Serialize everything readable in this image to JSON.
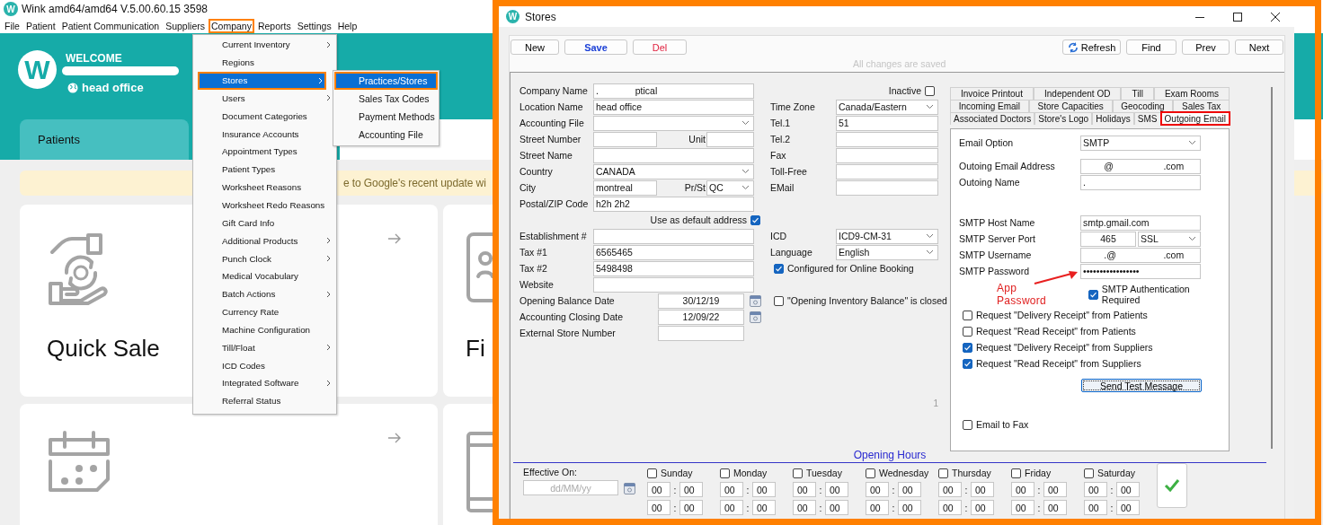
{
  "app": {
    "icon_letter": "W",
    "title": "Wink amd64/amd64 V.5.00.60.15 3598",
    "menu": [
      {
        "label": "File",
        "selected": false
      },
      {
        "label": "Patient",
        "selected": false
      },
      {
        "label": "Patient Communication",
        "selected": false
      },
      {
        "label": "Suppliers",
        "selected": false
      },
      {
        "label": "Company",
        "selected": true
      },
      {
        "label": "Reports",
        "selected": false
      },
      {
        "label": "Settings",
        "selected": false
      },
      {
        "label": "Help",
        "selected": false
      }
    ],
    "header": {
      "logo_letter": "W",
      "welcome": "WELCOME",
      "location": "head office"
    },
    "tab": "Patients",
    "notice": "e to Google's recent update wi",
    "cards": [
      {
        "kind": "money",
        "label": "Quick Sale",
        "arrow": true
      },
      {
        "kind": "tablet",
        "label": "Fi"
      },
      {
        "kind": "calendar",
        "arrow": true
      },
      {
        "kind": "phone"
      }
    ]
  },
  "company_menu": [
    {
      "label": "Current Inventory",
      "submenu": true,
      "selected": false
    },
    {
      "label": "Regions",
      "submenu": false,
      "selected": false
    },
    {
      "label": "Stores",
      "submenu": true,
      "selected": true
    },
    {
      "label": "Users",
      "submenu": true,
      "selected": false
    },
    {
      "label": "Document Categories",
      "submenu": false,
      "selected": false
    },
    {
      "label": "Insurance Accounts",
      "submenu": false,
      "selected": false
    },
    {
      "label": "Appointment Types",
      "submenu": false,
      "selected": false
    },
    {
      "label": "Patient Types",
      "submenu": false,
      "selected": false
    },
    {
      "label": "Worksheet Reasons",
      "submenu": false,
      "selected": false
    },
    {
      "label": "Worksheet Redo Reasons",
      "submenu": false,
      "selected": false
    },
    {
      "label": "Gift Card Info",
      "submenu": false,
      "selected": false
    },
    {
      "label": "Additional Products",
      "submenu": true,
      "selected": false
    },
    {
      "label": "Punch Clock",
      "submenu": true,
      "selected": false
    },
    {
      "label": "Medical Vocabulary",
      "submenu": false,
      "selected": false
    },
    {
      "label": "Batch Actions",
      "submenu": true,
      "selected": false
    },
    {
      "label": "Currency Rate",
      "submenu": false,
      "selected": false
    },
    {
      "label": "Machine Configuration",
      "submenu": false,
      "selected": false
    },
    {
      "label": "Till/Float",
      "submenu": true,
      "selected": false
    },
    {
      "label": "ICD Codes",
      "submenu": false,
      "selected": false
    },
    {
      "label": "Integrated Software",
      "submenu": true,
      "selected": false
    },
    {
      "label": "Referral Status",
      "submenu": false,
      "selected": false
    }
  ],
  "stores_submenu": [
    {
      "label": "Practices/Stores",
      "selected": true
    },
    {
      "label": "Sales Tax Codes",
      "selected": false
    },
    {
      "label": "Payment Methods",
      "selected": false
    },
    {
      "label": "Accounting File",
      "selected": false
    }
  ],
  "stores": {
    "icon_letter": "W",
    "title": "Stores",
    "toolbar_left": [
      {
        "label": "New",
        "kind": "plain"
      },
      {
        "label": "Save",
        "kind": "save"
      },
      {
        "label": "Del",
        "kind": "delete"
      }
    ],
    "toolbar_right": [
      {
        "label": "Refresh",
        "kind": "refresh"
      },
      {
        "label": "Find",
        "kind": "plain"
      },
      {
        "label": "Prev",
        "kind": "plain"
      },
      {
        "label": "Next",
        "kind": "plain"
      }
    ],
    "status": "All changes are saved",
    "left_fields": [
      {
        "kind": "text",
        "label": "Company Name",
        "value": ".              ptical"
      },
      {
        "kind": "text",
        "label": "Location Name",
        "value": "head office"
      },
      {
        "kind": "select",
        "label": "Accounting File"
      },
      {
        "kind": "pair",
        "label": "Street Number",
        "second": {
          "kind": "text",
          "label": "Unit"
        }
      },
      {
        "kind": "text",
        "label": "Street Name"
      },
      {
        "kind": "select",
        "label": "Country",
        "value": "CANADA"
      },
      {
        "kind": "pair",
        "label": "City",
        "value": "montreal",
        "second": {
          "kind": "select",
          "label": "Pr/St",
          "value": "QC"
        }
      },
      {
        "kind": "text",
        "label": "Postal/ZIP Code",
        "value": "h2h 2h2"
      },
      {
        "kind": "checkbox_end",
        "label": "Use as default address",
        "checked": true
      },
      {
        "kind": "text",
        "label": "Establishment #"
      },
      {
        "kind": "text",
        "label": "Tax #1",
        "value": "6565465"
      },
      {
        "kind": "text",
        "label": "Tax #2",
        "value": "5498498"
      },
      {
        "kind": "text",
        "label": "Website"
      },
      {
        "kind": "date",
        "label": "Opening Balance Date",
        "value": "30/12/19"
      },
      {
        "kind": "date",
        "label": "Accounting Closing Date",
        "value": "12/09/22"
      },
      {
        "kind": "date",
        "label": "External Store Number"
      }
    ],
    "right_groups": [
      [
        {
          "kind": "checkbox_end",
          "label": "Inactive",
          "checked": false
        },
        {
          "kind": "select",
          "label": "Time Zone",
          "value": "Canada/Eastern"
        },
        {
          "kind": "text",
          "label": "Tel.1",
          "value": "51"
        },
        {
          "kind": "text",
          "label": "Tel.2"
        },
        {
          "kind": "text",
          "label": "Fax"
        },
        {
          "kind": "text",
          "label": "Toll-Free"
        },
        {
          "kind": "text",
          "label": "EMail"
        }
      ],
      [
        {
          "kind": "select",
          "label": "ICD",
          "value": "ICD9-CM-31"
        },
        {
          "kind": "select",
          "label": "Language",
          "value": "English"
        },
        {
          "kind": "checkbox",
          "label": "Configured for Online Booking",
          "checked": true
        }
      ],
      [
        {
          "kind": "checkbox",
          "label": "\"Opening Inventory Balance\" is closed",
          "checked": false
        }
      ]
    ],
    "marker": "1",
    "tabs": [
      [
        {
          "label": "Invoice Printout",
          "selected": false
        },
        {
          "label": "Independent OD",
          "selected": false
        },
        {
          "label": "Till",
          "selected": false
        },
        {
          "label": "Exam Rooms",
          "selected": false
        }
      ],
      [
        {
          "label": "Incoming Email",
          "selected": false
        },
        {
          "label": "Store Capacities",
          "selected": false
        },
        {
          "label": "Geocoding",
          "selected": false
        },
        {
          "label": "Sales Tax",
          "selected": false
        }
      ],
      [
        {
          "label": "Associated Doctors",
          "selected": false
        },
        {
          "label": "Store's Logo",
          "selected": false
        },
        {
          "label": "Holidays",
          "selected": false
        },
        {
          "label": "SMS",
          "selected": false
        },
        {
          "label": "Outgoing Email",
          "selected": true
        }
      ]
    ],
    "email_settings": [
      {
        "kind": "select",
        "label": "Email Option",
        "value": "SMTP"
      },
      {
        "kind": "text",
        "label": "Outoing Email Address",
        "value": "        @                   .com"
      },
      {
        "kind": "text",
        "label": "Outoing Name",
        "value": "."
      },
      {
        "kind": "text",
        "label": "SMTP Host Name",
        "value": "smtp.gmail.com"
      },
      {
        "kind": "port",
        "label": "SMTP Server Port",
        "value": "465",
        "security": "SSL"
      },
      {
        "kind": "text",
        "label": "SMTP Username",
        "value": "        .@                  .com"
      },
      {
        "kind": "text",
        "label": "SMTP Password",
        "value": "•••••••••••••••••"
      }
    ],
    "annotation": "App Password",
    "auth": {
      "label": "SMTP Authentication Required",
      "checked": true
    },
    "requests": [
      {
        "label": "Request \"Delivery Receipt\" from Patients",
        "checked": false
      },
      {
        "label": "Request \"Read Receipt\" from Patients",
        "checked": false
      },
      {
        "label": "Request \"Delivery Receipt\" from Suppliers",
        "checked": true
      },
      {
        "label": "Request \"Read Receipt\" from Suppliers",
        "checked": true
      }
    ],
    "test_button": "Send Test Message",
    "email_to_fax": {
      "label": "Email to Fax",
      "checked": false
    },
    "opening_hours": {
      "title": "Opening Hours",
      "effective_label": "Effective On:",
      "placeholder": "dd/MM/yy",
      "separator": ":",
      "days": [
        {
          "label": "Sunday",
          "checked": false,
          "times": [
            [
              "00",
              "00"
            ],
            [
              "00",
              "00"
            ]
          ]
        },
        {
          "label": "Monday",
          "checked": false,
          "times": [
            [
              "00",
              "00"
            ],
            [
              "00",
              "00"
            ]
          ]
        },
        {
          "label": "Tuesday",
          "checked": false,
          "times": [
            [
              "00",
              "00"
            ],
            [
              "00",
              "00"
            ]
          ]
        },
        {
          "label": "Wednesday",
          "checked": false,
          "times": [
            [
              "00",
              "00"
            ],
            [
              "00",
              "00"
            ]
          ]
        },
        {
          "label": "Thursday",
          "checked": false,
          "times": [
            [
              "00",
              "00"
            ],
            [
              "00",
              "00"
            ]
          ]
        },
        {
          "label": "Friday",
          "checked": false,
          "times": [
            [
              "00",
              "00"
            ],
            [
              "00",
              "00"
            ]
          ]
        },
        {
          "label": "Saturday",
          "checked": false,
          "times": [
            [
              "00",
              "00"
            ],
            [
              "00",
              "00"
            ]
          ]
        }
      ]
    }
  }
}
